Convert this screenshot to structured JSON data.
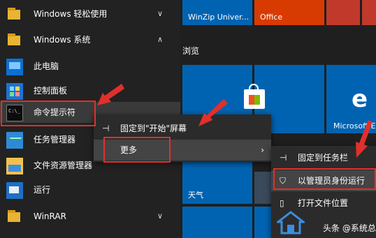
{
  "app_list": {
    "items": [
      {
        "label": "Windows 轻松使用",
        "icon": "folder-icon",
        "chevron": "chevron-down-icon"
      },
      {
        "label": "Windows 系统",
        "icon": "folder-icon",
        "chevron": "chevron-up-icon"
      },
      {
        "label": "此电脑",
        "icon": "this-pc-icon"
      },
      {
        "label": "控制面板",
        "icon": "control-panel-icon"
      },
      {
        "label": "命令提示符",
        "icon": "command-prompt-icon"
      },
      {
        "label": "任务管理器",
        "icon": "task-manager-icon"
      },
      {
        "label": "文件资源管理器",
        "icon": "file-explorer-icon"
      },
      {
        "label": "运行",
        "icon": "run-icon"
      },
      {
        "label": "WinRAR",
        "icon": "folder-icon",
        "chevron": "chevron-down-icon"
      }
    ]
  },
  "tiles": {
    "winzip": "WinZip Univer...",
    "office": "Office",
    "section_title": "浏览",
    "edge": "Microsoft Edge",
    "weather": "天气"
  },
  "context_menu": {
    "items": [
      {
        "icon": "pin-icon",
        "label": "固定到\"开始\"屏幕"
      },
      {
        "label": "更多",
        "has_submenu": true
      }
    ]
  },
  "submenu": {
    "items": [
      {
        "icon": "pin-icon",
        "label": "固定到任务栏"
      },
      {
        "icon": "admin-shield-icon",
        "label": "以管理员身份运行"
      },
      {
        "icon": "file-icon",
        "label": "打开文件位置"
      }
    ]
  },
  "watermark": {
    "text": "头条 @系统总裁"
  },
  "colors": {
    "tile_blue": "#0063b1",
    "office_red": "#d83b01",
    "highlight_red": "#e0302b"
  }
}
